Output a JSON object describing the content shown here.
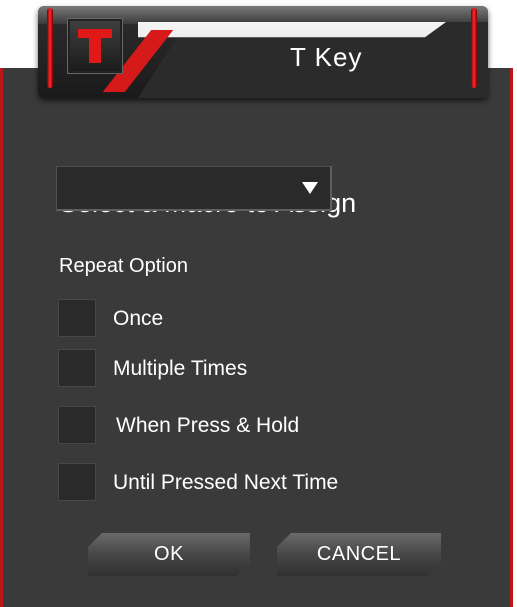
{
  "header": {
    "logo_letter": "T",
    "title": "T Key"
  },
  "macro": {
    "label": "Select a Macro to Assign",
    "selected_value": ""
  },
  "repeat": {
    "label": "Repeat Option",
    "options": [
      {
        "label": "Once",
        "checked": false
      },
      {
        "label": "Multiple Times",
        "checked": false
      },
      {
        "label": "When Press & Hold",
        "checked": false
      },
      {
        "label": "Until Pressed Next Time",
        "checked": false
      }
    ]
  },
  "buttons": {
    "ok": "OK",
    "cancel": "CANCEL"
  },
  "colors": {
    "accent": "#d61a1a",
    "panel": "#3a3a3a"
  }
}
